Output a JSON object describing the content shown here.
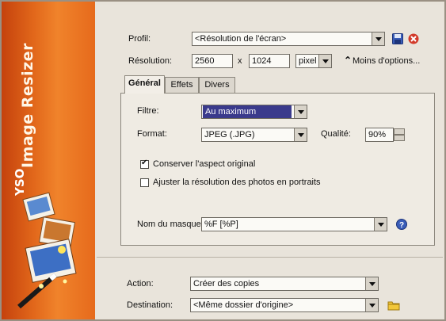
{
  "app": {
    "title": "Image Resizer",
    "logo_text": "YSO"
  },
  "profile": {
    "label": "Profil:",
    "value": "<Résolution de l'écran>"
  },
  "resolution": {
    "label": "Résolution:",
    "width": "2560",
    "separator": "x",
    "height": "1024",
    "unit": "pixel",
    "less_options": "Moins d'options..."
  },
  "tabs": [
    {
      "label": "Général"
    },
    {
      "label": "Effets"
    },
    {
      "label": "Divers"
    }
  ],
  "general": {
    "filter": {
      "label": "Filtre:",
      "value": "Au maximum"
    },
    "format": {
      "label": "Format:",
      "value": "JPEG (.JPG)"
    },
    "quality": {
      "label": "Qualité:",
      "value": "90%"
    },
    "keep_aspect": {
      "label": "Conserver l'aspect original",
      "checked": true
    },
    "adjust_portrait": {
      "label": "Ajuster la résolution des photos en portraits",
      "checked": false
    },
    "mask": {
      "label": "Nom du masque:",
      "value": "%F [%P]"
    }
  },
  "action": {
    "label": "Action:",
    "value": "Créer des copies"
  },
  "destination": {
    "label": "Destination:",
    "value": "<Même dossier d'origine>"
  },
  "colors": {
    "banner": "#e2681b",
    "selection": "#3a3a8c",
    "save_icon": "#3a5db8",
    "delete_icon": "#d23a2a"
  }
}
